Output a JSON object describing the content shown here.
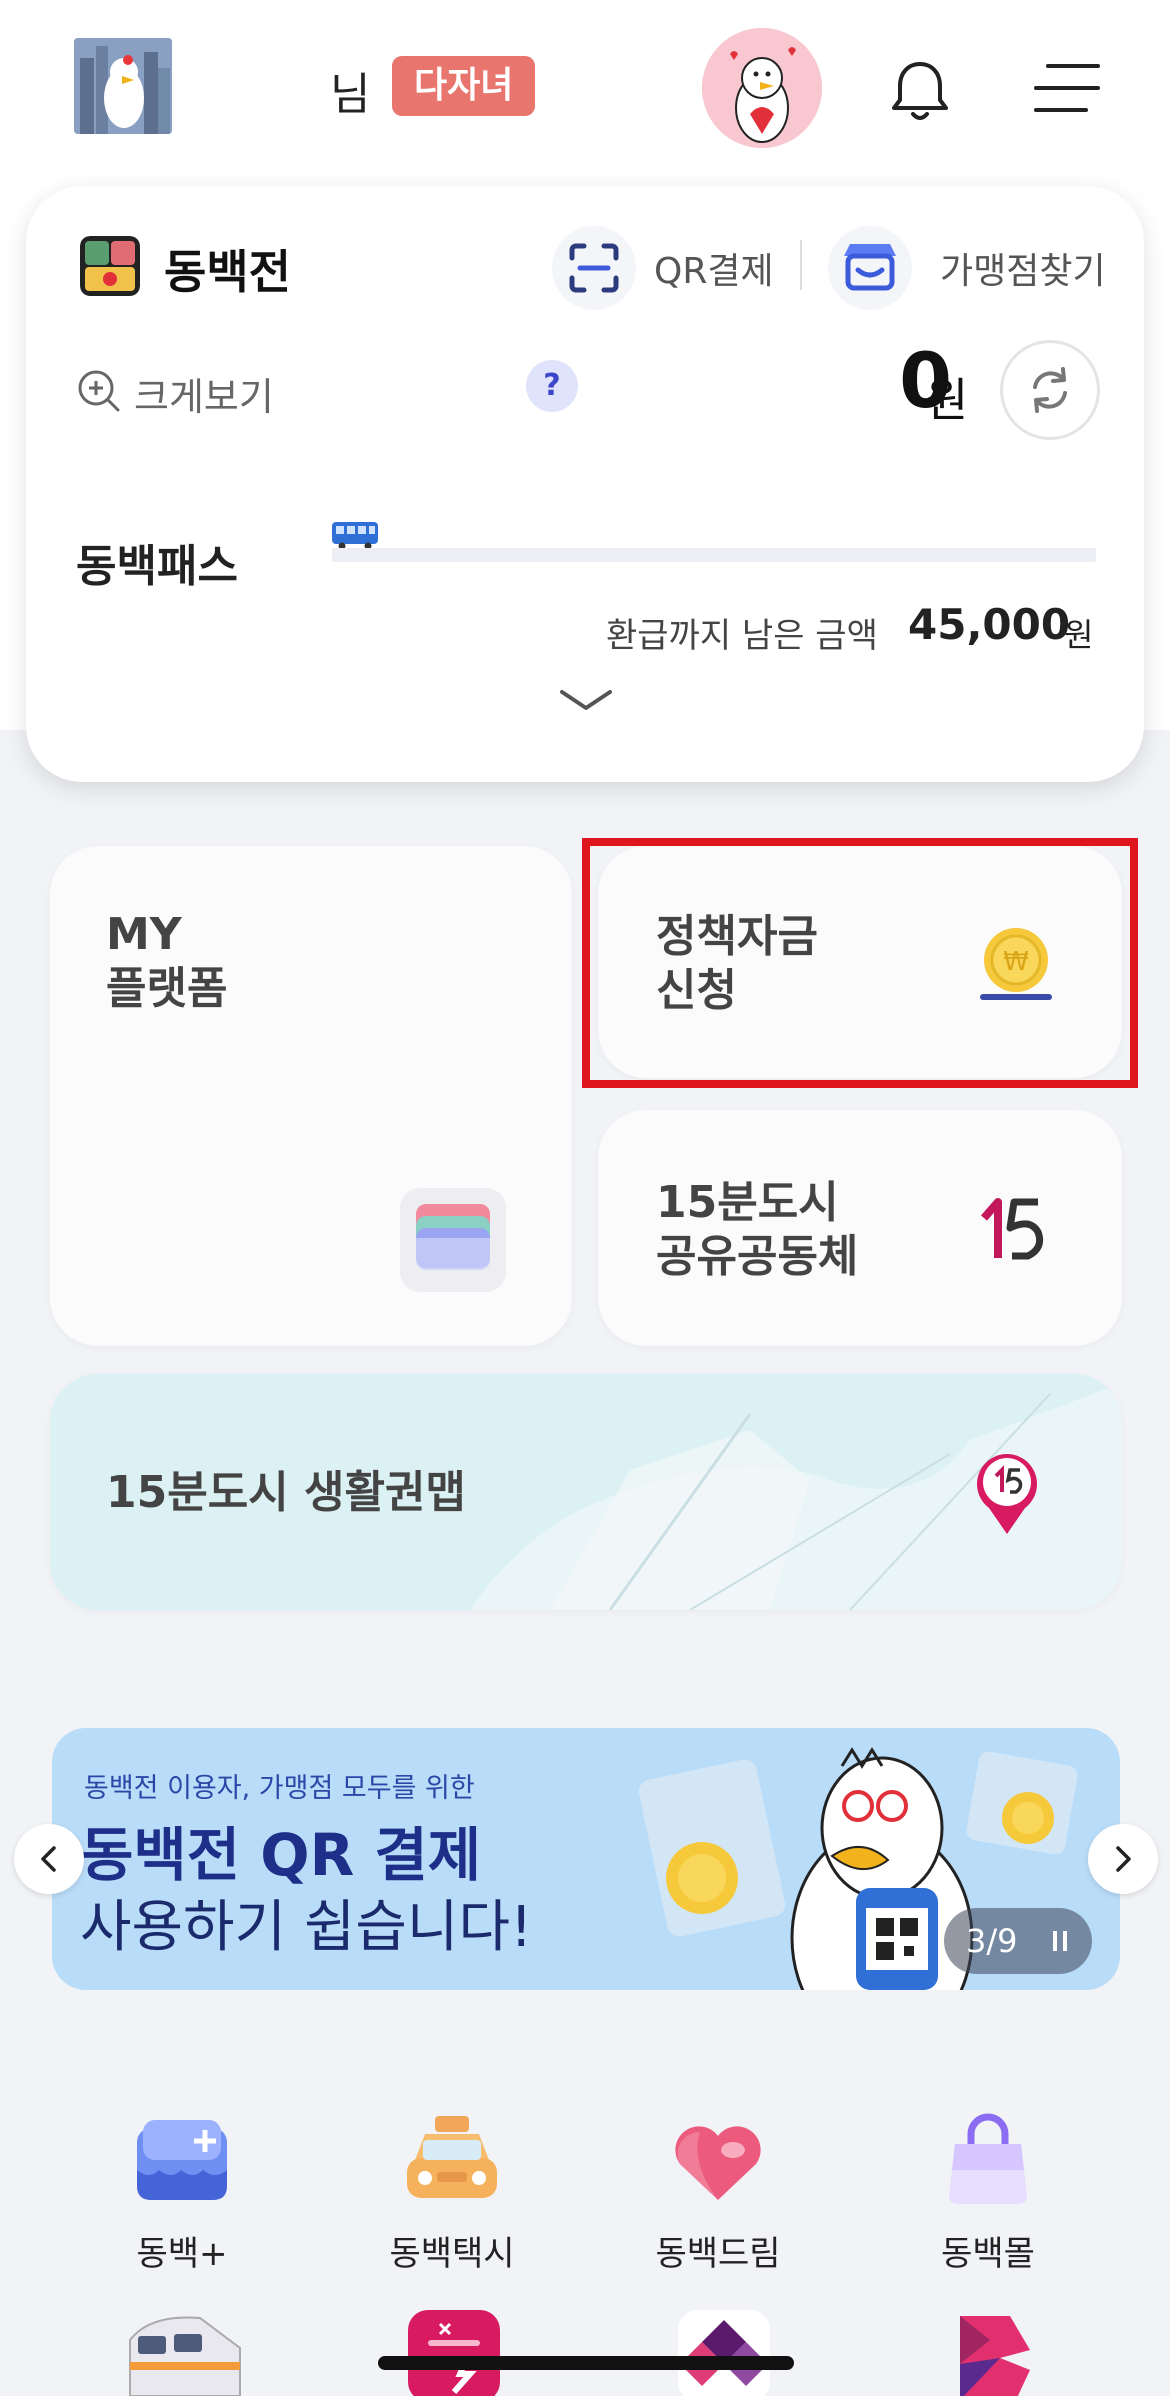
{
  "header": {
    "user_suffix": "님",
    "family_badge": "다자녀"
  },
  "wallet": {
    "brand": "동백전",
    "qr_pay": "QR결제",
    "find_store": "가맹점찾기",
    "zoom": "크게보기",
    "help": "?",
    "balance": "0",
    "balance_unit": "원",
    "pass_label": "동백패스",
    "refund_label": "환급까지 남은 금액",
    "refund_amount": "45,000",
    "refund_unit": "원"
  },
  "tiles": {
    "my_platform": "MY\n플랫폼",
    "policy_fund": "정책자금\n신청",
    "city15": "15분도시\n공유공동체",
    "life_map": "15분도시 생활권맵"
  },
  "banner": {
    "subtitle": "동백전 이용자, 가맹점 모두를 위한",
    "title": "동백전 QR 결제",
    "title2": "사용하기 쉽습니다!",
    "counter": "3/9"
  },
  "services": [
    {
      "label": "동백+",
      "icon": "dongbaek-plus-icon"
    },
    {
      "label": "동백택시",
      "icon": "taxi-icon"
    },
    {
      "label": "동백드림",
      "icon": "heart-icon"
    },
    {
      "label": "동백몰",
      "icon": "shopping-bag-icon"
    }
  ],
  "colors": {
    "badge": "#e8766e",
    "highlight": "#e0161e",
    "banner_bg": "#b9dcf8",
    "banner_title": "#1d2f89"
  }
}
